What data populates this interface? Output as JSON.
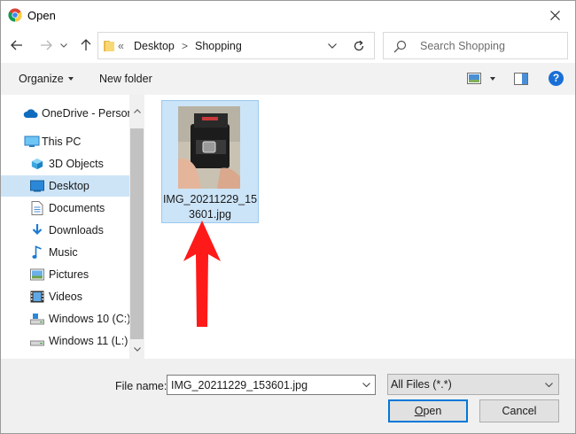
{
  "window": {
    "title": "Open"
  },
  "address": {
    "overflow_marker": "«",
    "crumbs": [
      "Desktop",
      "Shopping"
    ],
    "separator": ">"
  },
  "search": {
    "placeholder": "Search Shopping"
  },
  "toolbar": {
    "organize_label": "Organize",
    "new_folder_label": "New folder",
    "help_label": "?"
  },
  "sidebar": {
    "items": [
      {
        "label": "OneDrive - Person",
        "icon": "cloud-icon"
      },
      {
        "label": "This PC",
        "icon": "computer-icon"
      },
      {
        "label": "3D Objects",
        "icon": "cube-icon"
      },
      {
        "label": "Desktop",
        "icon": "desktop-icon",
        "selected": true
      },
      {
        "label": "Documents",
        "icon": "document-icon"
      },
      {
        "label": "Downloads",
        "icon": "download-icon"
      },
      {
        "label": "Music",
        "icon": "music-icon"
      },
      {
        "label": "Pictures",
        "icon": "pictures-icon"
      },
      {
        "label": "Videos",
        "icon": "video-icon"
      },
      {
        "label": "Windows 10 (C:)",
        "icon": "drive-icon"
      },
      {
        "label": "Windows 11 (L:)",
        "icon": "drive-icon"
      }
    ]
  },
  "files": [
    {
      "name": "IMG_20211229_153601.jpg",
      "selected": true
    }
  ],
  "footer": {
    "file_name_label": "File name:",
    "file_name_value": "IMG_20211229_153601.jpg",
    "filter_value": "All Files (*.*)",
    "open_first": "O",
    "open_rest": "pen",
    "cancel_label": "Cancel"
  },
  "colors": {
    "accent": "#0078d7",
    "selection": "#cce4f7",
    "annotation_arrow": "#ff1a1a"
  }
}
